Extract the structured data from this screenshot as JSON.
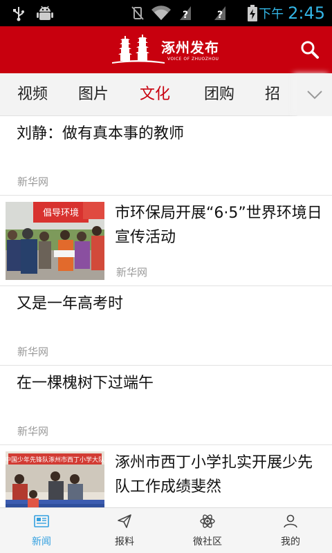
{
  "status_bar": {
    "icons": [
      "usb-icon",
      "android-debug-icon",
      "vibrate-icon",
      "wifi-icon",
      "no-signal-icon",
      "no-signal-icon",
      "battery-charging-icon"
    ],
    "ampm": "下午",
    "time": "2:45"
  },
  "header": {
    "logo_title": "涿州发布",
    "logo_subtitle": "VOICE OF ZHUOZHOU",
    "brand_color": "#c8000e"
  },
  "tabs": [
    {
      "label": "视频",
      "active": false
    },
    {
      "label": "图片",
      "active": false
    },
    {
      "label": "文化",
      "active": true
    },
    {
      "label": "团购",
      "active": false
    },
    {
      "label": "招",
      "active": false
    }
  ],
  "news": [
    {
      "title": "刘静：做有真本事的教师",
      "source": "新华网",
      "has_image": false
    },
    {
      "title": "市环保局开展“6·5”世界环境日宣传活动",
      "source": "新华网",
      "has_image": true,
      "image_banner": "倡导环境"
    },
    {
      "title": "又是一年高考时",
      "source": "新华网",
      "has_image": false
    },
    {
      "title": "在一棵槐树下过端午",
      "source": "新华网",
      "has_image": false
    },
    {
      "title": "涿州市西丁小学扎实开展少先队工作成绩斐然",
      "source": "",
      "has_image": true,
      "image_banner": "中国少年先锋队涿州市西丁小学大队"
    }
  ],
  "bottom_nav": [
    {
      "label": "新闻",
      "icon": "newspaper-icon",
      "active": true
    },
    {
      "label": "报料",
      "icon": "paper-plane-icon",
      "active": false
    },
    {
      "label": "微社区",
      "icon": "atom-icon",
      "active": false
    },
    {
      "label": "我的",
      "icon": "user-icon",
      "active": false
    }
  ],
  "colors": {
    "accent": "#c8000e",
    "nav_active": "#33a0e0",
    "status_time": "#33b5e5"
  }
}
